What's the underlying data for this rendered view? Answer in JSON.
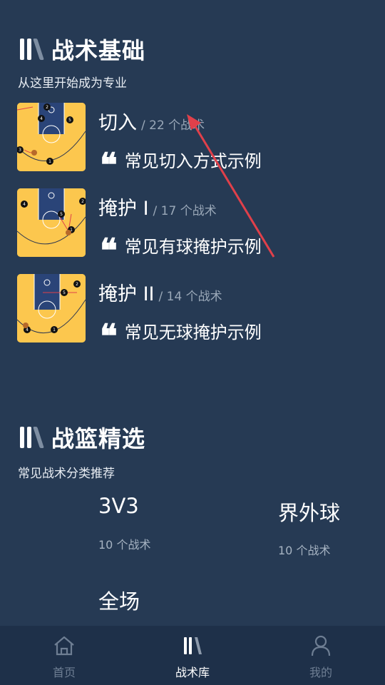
{
  "basics": {
    "title": "战术基础",
    "subtitle": "从这里开始成为专业",
    "items": [
      {
        "name": "切入",
        "count": "/ 22 个战术",
        "desc": "常见切入方式示例",
        "diagram_icon": "court-diagram-cut"
      },
      {
        "name": "掩护 I",
        "count": "/ 17 个战术",
        "desc": "常见有球掩护示例",
        "diagram_icon": "court-diagram-ball-screen"
      },
      {
        "name": "掩护 II",
        "count": "/ 14 个战术",
        "desc": "常见无球掩护示例",
        "diagram_icon": "court-diagram-off-ball-screen"
      }
    ],
    "quote_glyph": "❝"
  },
  "featured": {
    "title": "战篮精选",
    "subtitle": "常见战术分类推荐",
    "categories": [
      {
        "name": "3V3",
        "count": "10 个战术"
      },
      {
        "name": "界外球",
        "count": "10 个战术"
      },
      {
        "name": "全场",
        "count": ""
      }
    ]
  },
  "tabbar": {
    "tabs": [
      {
        "label": "首页",
        "icon": "home-icon",
        "active": false
      },
      {
        "label": "战术库",
        "icon": "tactics-logo-icon",
        "active": true
      },
      {
        "label": "我的",
        "icon": "person-icon",
        "active": false
      }
    ]
  },
  "colors": {
    "background": "#263a54",
    "tabbar": "#1e3049",
    "court": "#fcc74e",
    "paint": "#2a4478",
    "annotation_arrow": "#e0404a"
  }
}
